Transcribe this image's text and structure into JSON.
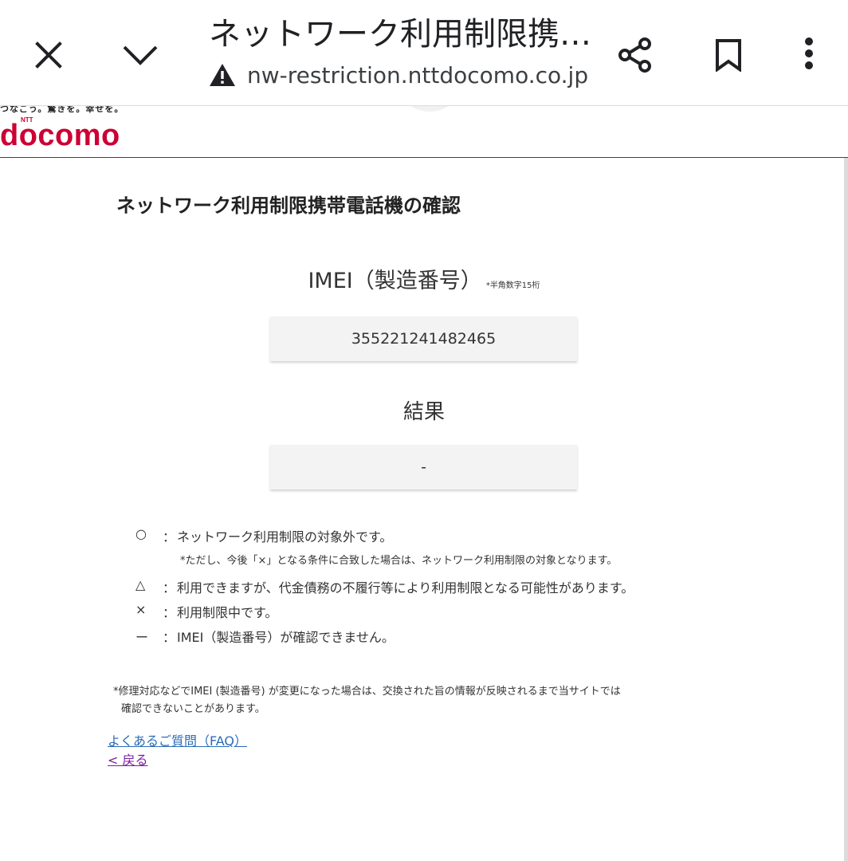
{
  "browser": {
    "page_title": "ネットワーク利用制限携…",
    "url": "nw-restriction.nttdocomo.co.jp",
    "close_icon": "close-icon",
    "chevron_icon": "chevron-down-icon",
    "share_icon": "share-icon",
    "bookmark_icon": "bookmark-icon",
    "menu_icon": "more-vert-icon",
    "warning_icon": "warning-icon"
  },
  "header": {
    "tagline": "つなごう。驚きを。幸せを。",
    "logo_text": "docomo",
    "logo_small": "NTT",
    "brand_color": "#cc0033"
  },
  "main": {
    "heading": "ネットワーク利用制限携帯電話機の確認",
    "imei_label": "IMEI（製造番号）",
    "imei_hint": "*半角数字15桁",
    "imei_value": "355221241482465",
    "result_label": "結果",
    "result_value": "-"
  },
  "legend": {
    "items": [
      {
        "symbol": "○",
        "colon": "：",
        "text": "ネットワーク利用制限の対象外です。"
      },
      {
        "symbol": "△",
        "colon": "：",
        "text": "利用できますが、代金債務の不履行等により利用制限となる可能性があります。"
      },
      {
        "symbol": "×",
        "colon": "：",
        "text": "利用制限中です。"
      },
      {
        "symbol": "ー",
        "colon": "：",
        "text": "IMEI（製造番号）が確認できません。"
      }
    ],
    "sub_note": "*ただし、今後「×」となる条件に合致した場合は、ネットワーク利用制限の対象となります。"
  },
  "note": {
    "line1": "*修理対応などでIMEI (製造番号) が変更になった場合は、交換された旨の情報が反映されるまで当サイトでは",
    "line2": "確認できないことがあります。"
  },
  "links": {
    "faq": "よくあるご質問（FAQ）",
    "back": "< 戻る"
  }
}
